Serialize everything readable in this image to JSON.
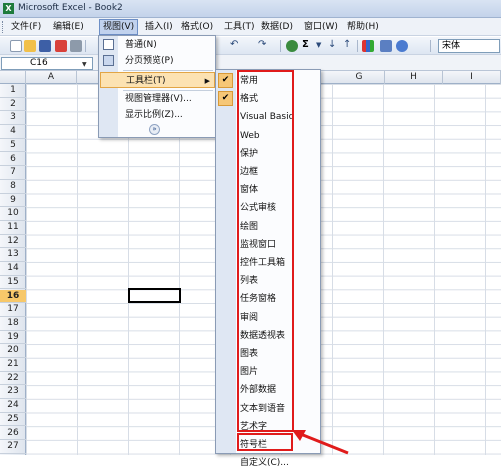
{
  "window": {
    "title": "Microsoft Excel - Book2"
  },
  "menubar": {
    "items": [
      {
        "label": "文件(F)"
      },
      {
        "label": "编辑(E)"
      },
      {
        "label": "视图(V)"
      },
      {
        "label": "插入(I)"
      },
      {
        "label": "格式(O)"
      },
      {
        "label": "工具(T)"
      },
      {
        "label": "数据(D)"
      },
      {
        "label": "窗口(W)"
      },
      {
        "label": "帮助(H)"
      }
    ],
    "active": "视图(V)"
  },
  "toolbar": {
    "font": "宋体",
    "icons": [
      "new-icon",
      "open-icon",
      "save-icon",
      "permission-icon",
      "print-icon",
      "undo-icon",
      "redo-icon",
      "hyperlink-icon",
      "autosum-icon",
      "sort-asc-icon",
      "sort-desc-icon",
      "chart-icon",
      "drawing-icon",
      "help-icon"
    ]
  },
  "formula_bar": {
    "name_box": "C16"
  },
  "columns": [
    "A",
    "G",
    "H",
    "I"
  ],
  "rows": [
    "1",
    "2",
    "3",
    "4",
    "5",
    "6",
    "7",
    "8",
    "9",
    "10",
    "11",
    "12",
    "13",
    "14",
    "15",
    "16",
    "17",
    "18",
    "19",
    "20",
    "21",
    "22",
    "23",
    "24",
    "25",
    "26",
    "27"
  ],
  "selected_row": "16",
  "view_menu": {
    "items": [
      {
        "label": "普通(N)",
        "icon": "normal-view-icon"
      },
      {
        "label": "分页预览(P)",
        "icon": "page-break-icon"
      },
      {
        "label": "工具栏(T)",
        "submenu": true
      },
      {
        "label": "视图管理器(V)..."
      },
      {
        "label": "显示比例(Z)..."
      }
    ],
    "highlighted": "工具栏(T)"
  },
  "toolbars_menu": {
    "items": [
      {
        "label": "常用",
        "checked": true
      },
      {
        "label": "格式",
        "checked": true
      },
      {
        "label": "Visual Basic",
        "checked": false
      },
      {
        "label": "Web",
        "checked": false
      },
      {
        "label": "保护",
        "checked": false
      },
      {
        "label": "边框",
        "checked": false
      },
      {
        "label": "窗体",
        "checked": false
      },
      {
        "label": "公式审核",
        "checked": false
      },
      {
        "label": "绘图",
        "checked": false
      },
      {
        "label": "监视窗口",
        "checked": false
      },
      {
        "label": "控件工具箱",
        "checked": false
      },
      {
        "label": "列表",
        "checked": false
      },
      {
        "label": "任务窗格",
        "checked": false
      },
      {
        "label": "审阅",
        "checked": false
      },
      {
        "label": "数据透视表",
        "checked": false
      },
      {
        "label": "图表",
        "checked": false
      },
      {
        "label": "图片",
        "checked": false
      },
      {
        "label": "外部数据",
        "checked": false
      },
      {
        "label": "文本到语音",
        "checked": false
      },
      {
        "label": "艺术字",
        "checked": false
      },
      {
        "label": "符号栏",
        "checked": false
      },
      {
        "label": "自定义(C)...",
        "checked": false
      }
    ]
  },
  "colors": {
    "highlight_border": "#e01b1b",
    "menu_highlight": "#fce2b2"
  }
}
